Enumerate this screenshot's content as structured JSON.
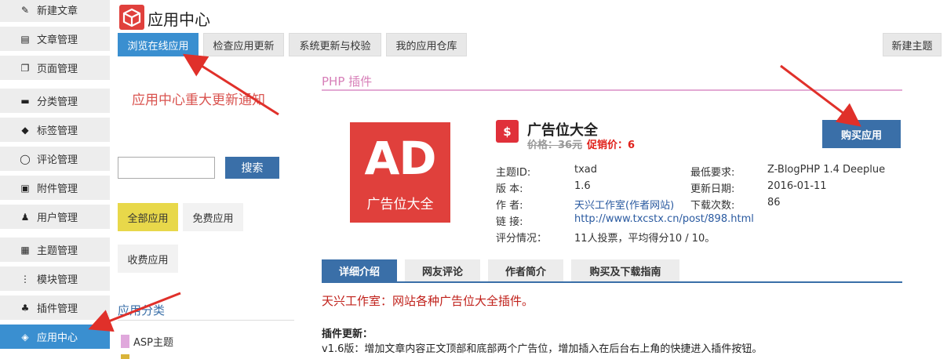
{
  "app": {
    "title": "应用中心",
    "logo_icon": "box-icon"
  },
  "sidebar": {
    "items": [
      {
        "label": "新建文章",
        "icon": "edit-icon"
      },
      {
        "label": "文章管理",
        "icon": "article-icon"
      },
      {
        "label": "页面管理",
        "icon": "pages-icon"
      },
      {
        "label": "分类管理",
        "icon": "folder-icon"
      },
      {
        "label": "标签管理",
        "icon": "tag-icon"
      },
      {
        "label": "评论管理",
        "icon": "comment-icon"
      },
      {
        "label": "附件管理",
        "icon": "attachment-icon"
      },
      {
        "label": "用户管理",
        "icon": "user-icon"
      },
      {
        "label": "主题管理",
        "icon": "theme-icon"
      },
      {
        "label": "模块管理",
        "icon": "module-icon"
      },
      {
        "label": "插件管理",
        "icon": "plugin-icon"
      },
      {
        "label": "应用中心",
        "icon": "cube-icon",
        "active": true
      }
    ]
  },
  "tabs": [
    {
      "label": "浏览在线应用",
      "active": true
    },
    {
      "label": "检查应用更新"
    },
    {
      "label": "系统更新与校验"
    },
    {
      "label": "我的应用仓库"
    }
  ],
  "new_theme_label": "新建主题",
  "notice": "应用中心重大更新通知",
  "search": {
    "value": "",
    "button_label": "搜索"
  },
  "filters": [
    {
      "label": "全部应用",
      "active": true
    },
    {
      "label": "免费应用"
    },
    {
      "label": "收费应用"
    }
  ],
  "categories": {
    "title": "应用分类",
    "items": [
      {
        "label": "ASP主题",
        "color": "#e0a8dc"
      }
    ]
  },
  "section_title": "PHP 插件",
  "plugin": {
    "image_text": "AD",
    "image_sub": "广告位大全",
    "icon_text": "$",
    "name": "广告位大全",
    "price_old": "价格：36元",
    "price_sale": "促销价：6",
    "buy_label": "购买应用",
    "info": {
      "id_label": "主题ID:",
      "id": "txad",
      "version_label": "版 本:",
      "version": "1.6",
      "author_label": "作 者:",
      "author": "天兴工作室(作者网站)",
      "link_label": "链 接:",
      "link": "http://www.txcstx.cn/post/898.html",
      "rating_label": "评分情况：",
      "rating": "11人投票，平均得分10 / 10。",
      "req_label": "最低要求:",
      "req": "Z-BlogPHP 1.4 Deeplue",
      "updated_label": "更新日期:",
      "updated": "2016-01-11",
      "downloads_label": "下载次数:",
      "downloads": "86"
    }
  },
  "content_tabs": [
    {
      "label": "详细介绍",
      "active": true
    },
    {
      "label": "网友评论"
    },
    {
      "label": "作者简介"
    },
    {
      "label": "购买及下载指南"
    }
  ],
  "description": "天兴工作室：网站各种广告位大全插件。",
  "update_title": "插件更新：",
  "update_v16": "v1.6版：增加文章内容正文顶部和底部两个广告位，增加插入在后台右上角的快捷进入插件按钮。",
  "colors": {
    "accent": "#3a8fd0",
    "button": "#3a6fa8",
    "ad_red": "#e0403c",
    "annotation_red": "#e0302a"
  }
}
